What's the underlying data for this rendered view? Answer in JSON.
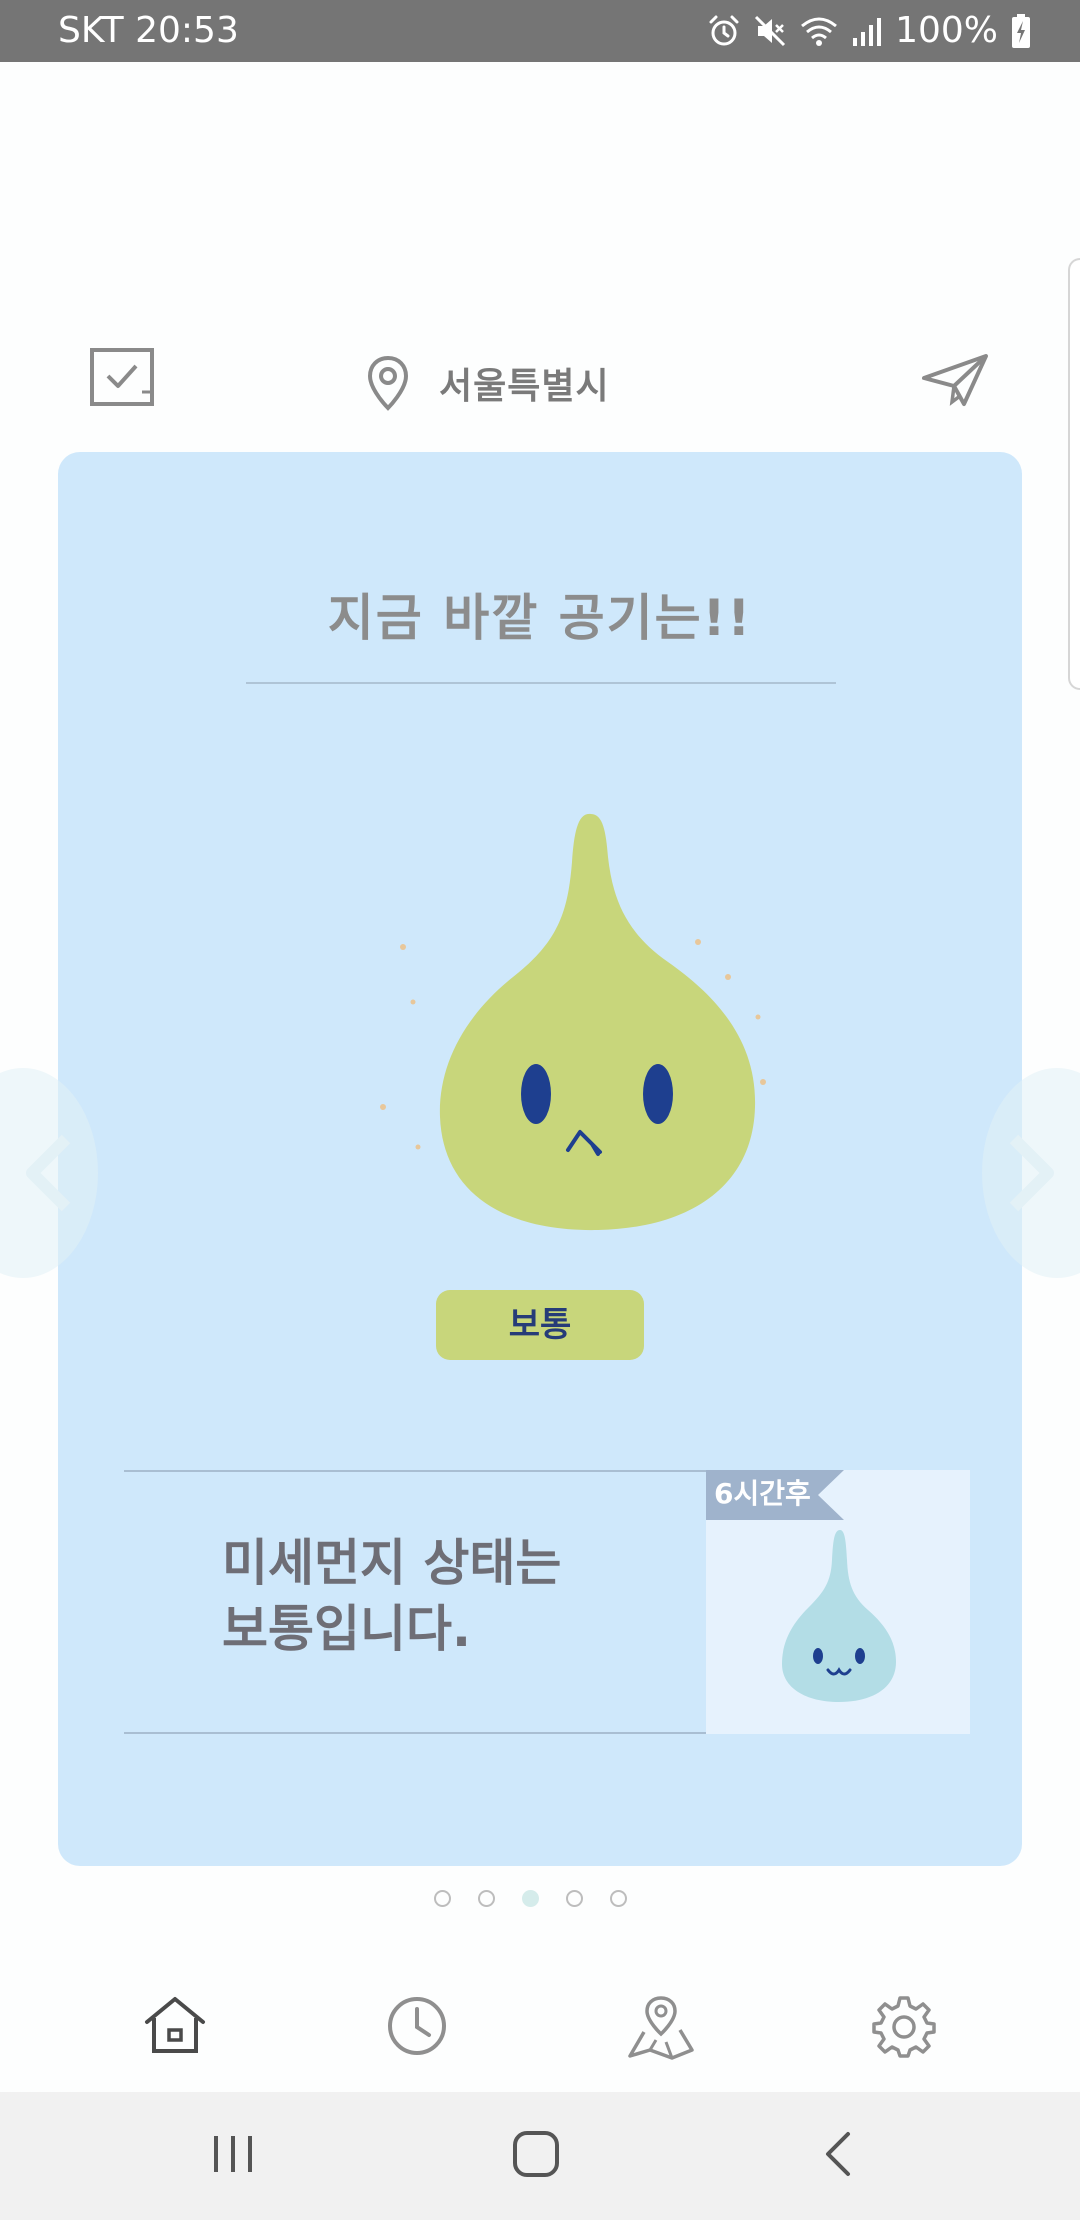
{
  "status_bar": {
    "carrier_time": "SKT 20:53",
    "battery_percent": "100%",
    "icons": [
      "alarm-icon",
      "mute-icon",
      "wifi-icon",
      "signal-icon",
      "battery-charging-icon"
    ]
  },
  "header": {
    "left_icon": "checklist-icon",
    "location_icon": "location-pin-icon",
    "city": "서울특별시",
    "right_icon": "send-icon"
  },
  "card": {
    "title": "지금 바깥 공기는!!",
    "grade": "보통",
    "message_line1": "미세먼지 상태는",
    "message_line2": "보통입니다.",
    "forecast_label": "6시간후",
    "colors": {
      "card_bg": "#CFE8FB",
      "mascot_now": "#C8D67B",
      "mascot_forecast": "#B3DDE6",
      "eyes": "#1E3F8F"
    }
  },
  "pagination": {
    "count": 5,
    "active_index": 2
  },
  "bottom_nav": {
    "items": [
      {
        "icon": "home-icon"
      },
      {
        "icon": "clock-icon"
      },
      {
        "icon": "map-pin-icon"
      },
      {
        "icon": "settings-gear-icon"
      }
    ]
  },
  "system_nav": {
    "items": [
      "recent-apps-icon",
      "home-circle-icon",
      "back-chevron-icon"
    ]
  }
}
